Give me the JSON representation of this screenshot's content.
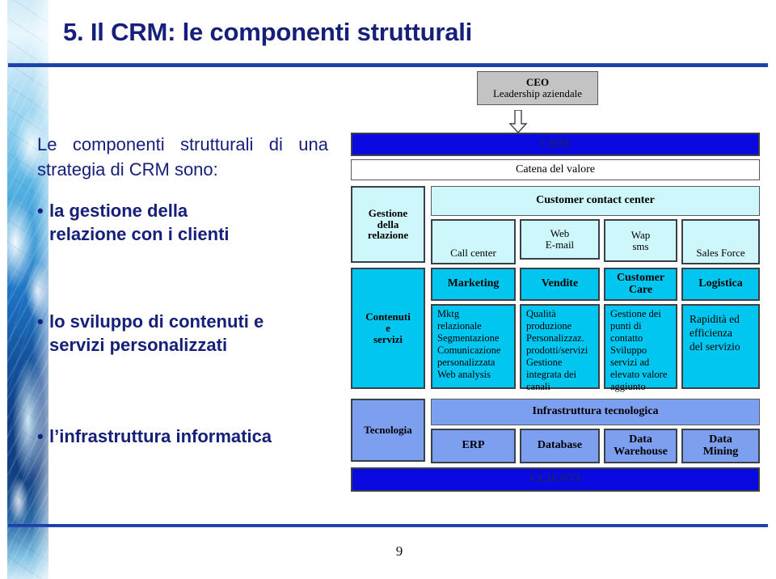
{
  "slide": {
    "title": "5. Il CRM: le componenti strutturali",
    "page_number": "9",
    "accent_color": "#1f3fa8",
    "text_color": "#16207a"
  },
  "left_column": {
    "intro": "Le componenti strutturali di una strategia di CRM sono:",
    "bullet_marker": "•",
    "bullets": [
      {
        "line1": "la gestione della",
        "line2": "relazione con i clienti"
      },
      {
        "line1": "lo sviluppo di contenuti e",
        "line2": "servizi personalizzati"
      },
      {
        "line1": "l’infrastruttura informatica",
        "line2": ""
      }
    ]
  },
  "diagram": {
    "ceo": {
      "line1": "CEO",
      "line2": "Leadership aziendale",
      "color": "#c3c3c3"
    },
    "crm_bar": {
      "label": "CRM",
      "color": "#0a0ae0"
    },
    "value_chain": {
      "label": "Catena del valore",
      "color": "#ffffff"
    },
    "row_relation": {
      "side_label": {
        "line1": "Gestione",
        "line2": "della",
        "line3": "relazione"
      },
      "header": "Customer contact center",
      "cells": [
        {
          "line1": "Call center",
          "line2": ""
        },
        {
          "line1": "Web",
          "line2": "E-mail"
        },
        {
          "line1": "Wap",
          "line2": "sms"
        },
        {
          "line1": "Sales Force",
          "line2": ""
        }
      ],
      "color": "#cdf7fb"
    },
    "row_content": {
      "side_label": {
        "line1": "Contenuti",
        "line2": "e",
        "line3": "servizi"
      },
      "headers": [
        "Marketing",
        "Vendite",
        "Customer\nCare",
        "Logistica"
      ],
      "header_marketing": "Marketing",
      "header_vendite": "Vendite",
      "header_customer_care_l1": "Customer",
      "header_customer_care_l2": "Care",
      "header_logistica": "Logistica",
      "cells": [
        "Mktg\nrelazionale\nSegmentazione\nComunicazione\npersonalizzata\n Web analysis",
        "Qualità\nproduzione\nPersonalizzaz.\nprodotti/servizi\nGestione\nintegrata dei\ncanali",
        "Gestione dei\npunti di\ncontatto\nSviluppo\nservizi ad\nelevato valore\naggiunto",
        "Rapidità ed\nefficienza\ndel servizio"
      ],
      "color": "#00c6f0"
    },
    "row_tech": {
      "side_label": "Tecnologia",
      "header": "Infrastruttura tecnologica",
      "cells": [
        {
          "line1": "ERP",
          "line2": ""
        },
        {
          "line1": "Database",
          "line2": ""
        },
        {
          "line1": "Data",
          "line2": "Warehouse"
        },
        {
          "line1": "Data",
          "line2": "Mining"
        }
      ],
      "color": "#7d9ff0"
    },
    "clients_bar": {
      "label": "CLIENTI",
      "color": "#0a0ae0"
    }
  }
}
